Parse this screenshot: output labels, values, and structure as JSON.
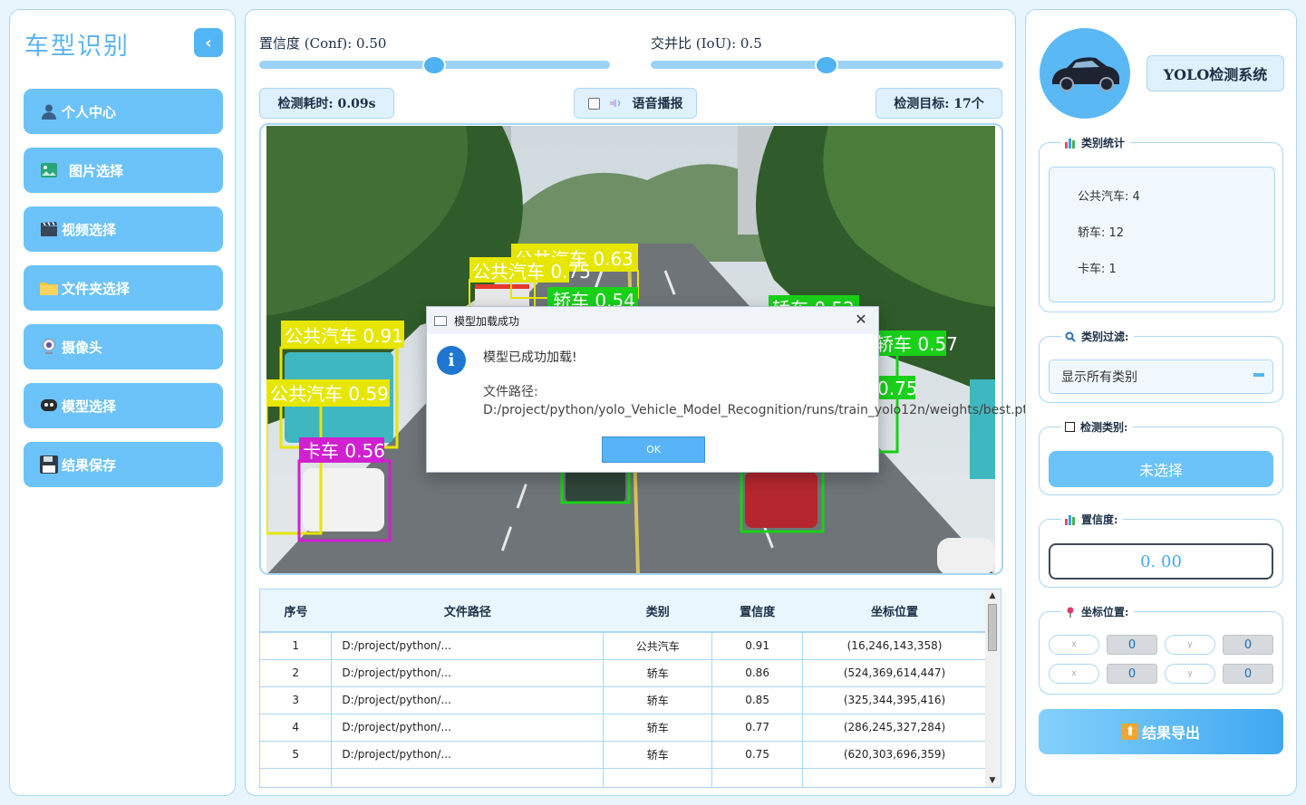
{
  "sidebar": {
    "title": "车型识别",
    "items": [
      {
        "label": "个人中心",
        "icon": "user-icon"
      },
      {
        "label": "图片选择",
        "icon": "image-icon"
      },
      {
        "label": "视频选择",
        "icon": "clapperboard-icon"
      },
      {
        "label": "文件夹选择",
        "icon": "folder-icon"
      },
      {
        "label": "摄像头",
        "icon": "webcam-icon"
      },
      {
        "label": "模型选择",
        "icon": "model-icon"
      },
      {
        "label": "结果保存",
        "icon": "floppy-disk-icon"
      }
    ]
  },
  "controls": {
    "conf_label": "置信度 (Conf): 0.50",
    "conf_value": 0.5,
    "iou_label": "交并比 (IoU): 0.5",
    "iou_value": 0.5,
    "time_label": "检测耗时: 0.09s",
    "voice_label": "语音播报",
    "voice_checked": false,
    "targets_label": "检测目标: 17个"
  },
  "detections_overlay": [
    {
      "label": "公共汽车 0.63",
      "color": "#e6e600"
    },
    {
      "label": "公共汽车 0.75",
      "color": "#e6e600"
    },
    {
      "label": "轿车 0.54",
      "color": "#19d119"
    },
    {
      "label": "轿车 0.52",
      "color": "#19d119"
    },
    {
      "label": "公共汽车 0.91",
      "color": "#e6e600"
    },
    {
      "label": "公共汽车 0.59",
      "color": "#e6e600"
    },
    {
      "label": "卡车 0.56",
      "color": "#d020d0"
    },
    {
      "label": "轿车 0.57",
      "color": "#19d119"
    },
    {
      "label": "0.75",
      "color": "#19d119"
    }
  ],
  "dialog": {
    "title": "模型加载成功",
    "message": "模型已成功加载!",
    "path": "文件路径: D:/project/python/yolo_Vehicle_Model_Recognition/runs/train_yolo12n/weights/best.pt",
    "ok": "OK",
    "close": "✕"
  },
  "table": {
    "headers": [
      "序号",
      "文件路径",
      "类别",
      "置信度",
      "坐标位置"
    ],
    "rows": [
      [
        "1",
        "D:/project/python/...",
        "公共汽车",
        "0.91",
        "(16,246,143,358)"
      ],
      [
        "2",
        "D:/project/python/...",
        "轿车",
        "0.86",
        "(524,369,614,447)"
      ],
      [
        "3",
        "D:/project/python/...",
        "轿车",
        "0.85",
        "(325,344,395,416)"
      ],
      [
        "4",
        "D:/project/python/...",
        "轿车",
        "0.77",
        "(286,245,327,284)"
      ],
      [
        "5",
        "D:/project/python/...",
        "轿车",
        "0.75",
        "(620,303,696,359)"
      ]
    ]
  },
  "right": {
    "system_title": "YOLO检测系统",
    "stats_title": "类别统计",
    "stats": [
      "公共汽车: 4",
      "轿车: 12",
      "卡车: 1"
    ],
    "filter_title": "类别过滤:",
    "filter_value": "显示所有类别",
    "detect_class_title": "检测类别:",
    "detect_class_value": "未选择",
    "conf_title": "置信度:",
    "conf_value": "0. 00",
    "coord_title": "坐标位置:",
    "coords": [
      {
        "label": "x",
        "value": "0"
      },
      {
        "label": "y",
        "value": "0"
      },
      {
        "label": "x",
        "value": "0"
      },
      {
        "label": "y",
        "value": "0"
      }
    ],
    "export_label": "结果导出"
  },
  "colors": {
    "accent": "#6cc3f9",
    "accent_dark": "#52b6f6",
    "border": "#a9d7f3"
  }
}
